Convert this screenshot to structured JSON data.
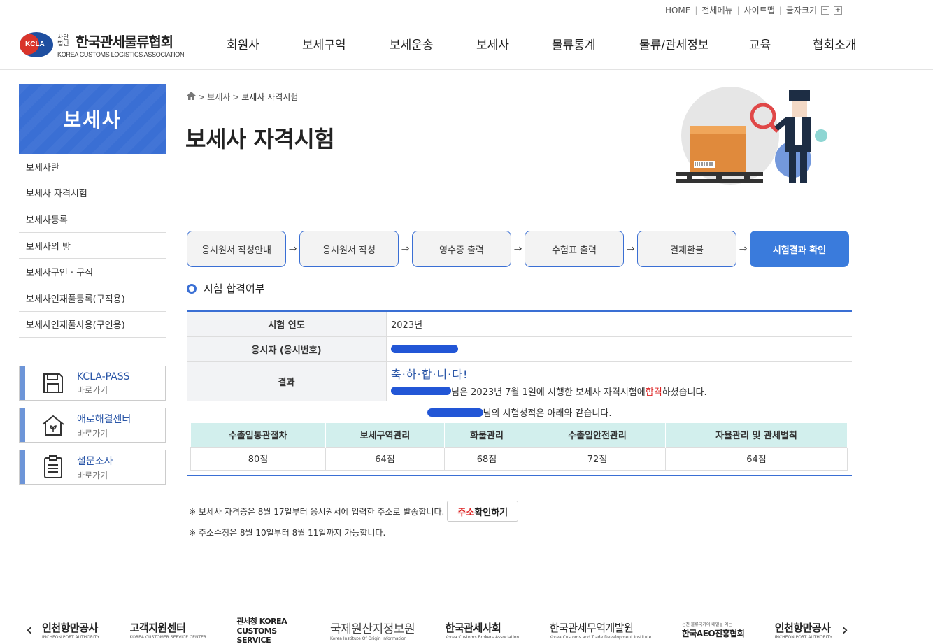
{
  "util": {
    "home": "HOME",
    "all_menu": "전체메뉴",
    "sitemap": "사이트맵",
    "font_size": "글자크기",
    "minus": "−",
    "plus": "+"
  },
  "logo": {
    "mark": "KCLA",
    "small": "사단 법인",
    "name": "한국관세물류협회",
    "en": "KOREA CUSTOMS LOGISTICS ASSOCIATION"
  },
  "gnb": [
    "회원사",
    "보세구역",
    "보세운송",
    "보세사",
    "물류통계",
    "물류/관세정보",
    "교육",
    "협회소개"
  ],
  "sidebar": {
    "title": "보세사",
    "items": [
      "보세사란",
      "보세사 자격시험",
      "보세사등록",
      "보세사의 방",
      "보세사구인 · 구직",
      "보세사인재풀등록(구직용)",
      "보세사인재풀사용(구인용)"
    ]
  },
  "quick": [
    {
      "title": "KCLA-PASS",
      "sub": "바로가기",
      "icon": "floppy-icon"
    },
    {
      "title": "애로해결센터",
      "sub": "바로가기",
      "icon": "house-icon"
    },
    {
      "title": "설문조사",
      "sub": "바로가기",
      "icon": "clipboard-icon"
    }
  ],
  "breadcrumb": {
    "level1": "보세사",
    "level2": "보세사 자격시험"
  },
  "page_title": "보세사 자격시험",
  "steps": [
    "응시원서 작성안내",
    "응시원서 작성",
    "영수증 출력",
    "수험표 출력",
    "결제환불",
    "시험결과 확인"
  ],
  "step_arrow": "⇒",
  "section_title": "시험 합격여부",
  "result": {
    "year_label": "시험 연도",
    "year_value": "2023년",
    "applicant_label": "응시자 (응시번호)",
    "result_label": "결과",
    "congrats": "축·하·합·니·다!",
    "msg_before": "님은 2023년 7월 1일에 시행한 보세사 자격시험에 ",
    "msg_pass": "합격",
    "msg_after": "하셨습니다.",
    "score_note": "님의 시험성적은 아래와 같습니다."
  },
  "scores": {
    "headers": [
      "수출입통관절차",
      "보세구역관리",
      "화물관리",
      "수출입안전관리",
      "자율관리 및 관세벌칙"
    ],
    "values": [
      "80점",
      "64점",
      "68점",
      "72점",
      "64점"
    ]
  },
  "notes": {
    "line1": "※ 보세사 자격증은 8월 17일부터 응시원서에 입력한 주소로 발송합니다.",
    "btn_red": "주소",
    "btn_rest": "확인하기",
    "line2": "※ 주소수정은 8월 10일부터 8월 11일까지 가능합니다."
  },
  "footer": {
    "prev": "‹",
    "next": "›",
    "banners": [
      {
        "main": "인천항만공사",
        "sub": "INCHEON PORT AUTHORITY"
      },
      {
        "main": "고객지원센터",
        "sub": "KOREA CUSTOMER SERVICE CENTER"
      },
      {
        "main": "관세청 KOREA CUSTOMS SERVICE",
        "sub": ""
      },
      {
        "main": "국제원산지정보원",
        "sub": "Korea Institute Of Origin Information"
      },
      {
        "main": "한국관세사회",
        "sub": "Korea Customs Brokers Association"
      },
      {
        "main": "한국관세무역개발원",
        "sub": "Korea Customs and Trade Development Institute"
      },
      {
        "main": "한국AEO진흥협회",
        "sub": "선진 물류국가의 내일을 여는"
      },
      {
        "main": "인천항만공사",
        "sub": "INCHEON PORT AUTHORITY"
      }
    ]
  },
  "colors": {
    "primary": "#3a6fd4",
    "active_step": "#3a7bdc",
    "score_header": "#d2efed",
    "pass": "#dd2222"
  }
}
